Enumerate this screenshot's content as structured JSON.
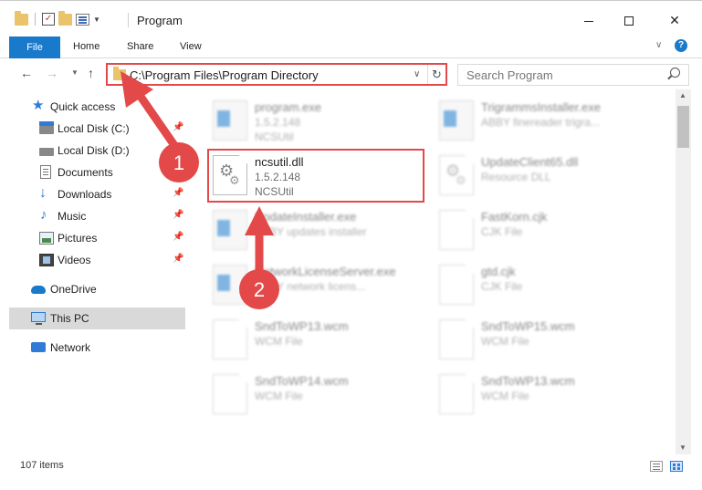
{
  "window": {
    "title": "Program"
  },
  "ribbon": {
    "file": "File",
    "home": "Home",
    "share": "Share",
    "view": "View",
    "help": "?"
  },
  "address": {
    "path": "C:\\Program Files\\Program Directory",
    "search_placeholder": "Search Program"
  },
  "sidebar": {
    "items": [
      {
        "label": "Quick access",
        "icon": "star-icon",
        "pinned": false
      },
      {
        "label": "Local Disk (C:)",
        "icon": "local-disk-icon",
        "pinned": true
      },
      {
        "label": "Local Disk (D:)",
        "icon": "local-disk-icon",
        "pinned": false
      },
      {
        "label": "Documents",
        "icon": "documents-icon",
        "pinned": true
      },
      {
        "label": "Downloads",
        "icon": "downloads-icon",
        "pinned": true
      },
      {
        "label": "Music",
        "icon": "music-icon",
        "pinned": true
      },
      {
        "label": "Pictures",
        "icon": "pictures-icon",
        "pinned": true
      },
      {
        "label": "Videos",
        "icon": "videos-icon",
        "pinned": true
      },
      {
        "label": "OneDrive",
        "icon": "onedrive-icon",
        "pinned": false
      },
      {
        "label": "This PC",
        "icon": "this-pc-icon",
        "pinned": false,
        "selected": true
      },
      {
        "label": "Network",
        "icon": "network-icon",
        "pinned": false
      }
    ]
  },
  "files": [
    {
      "name": "program.exe",
      "meta1": "1.5.2.148",
      "meta2": "NCSUtil",
      "icon": "exe-file-icon"
    },
    {
      "name": "TrigrammsInstaller.exe",
      "meta1": "ABBY finereader trigra...",
      "meta2": "",
      "icon": "exe-file-icon"
    },
    {
      "name": "ncsutil.dll",
      "meta1": "1.5.2.148",
      "meta2": "NCSUtil",
      "icon": "dll-file-icon"
    },
    {
      "name": "UpdateClient65.dll",
      "meta1": "Resource DLL",
      "meta2": "",
      "icon": "dll-file-icon"
    },
    {
      "name": "UpdateInstaller.exe",
      "meta1": "ABBY updates installer",
      "meta2": "",
      "icon": "exe-file-icon"
    },
    {
      "name": "FastKorn.cjk",
      "meta1": "CJK File",
      "meta2": "",
      "icon": "document-icon"
    },
    {
      "name": "NetworkLicenseServer.exe",
      "meta1": "ABBY network licens...",
      "meta2": "",
      "icon": "exe-file-icon"
    },
    {
      "name": "gtd.cjk",
      "meta1": "CJK File",
      "meta2": "",
      "icon": "document-icon"
    },
    {
      "name": "SndToWP13.wcm",
      "meta1": "WCM File",
      "meta2": "",
      "icon": "document-icon"
    },
    {
      "name": "SndToWP15.wcm",
      "meta1": "WCM File",
      "meta2": "",
      "icon": "document-icon"
    },
    {
      "name": "SndToWP14.wcm",
      "meta1": "WCM File",
      "meta2": "",
      "icon": "document-icon"
    },
    {
      "name": "SndToWP13.wcm",
      "meta1": "WCM File",
      "meta2": "",
      "icon": "document-icon"
    }
  ],
  "status": {
    "count": "107 items"
  },
  "annotations": {
    "step1": "1",
    "step2": "2",
    "color": "#e34949"
  }
}
